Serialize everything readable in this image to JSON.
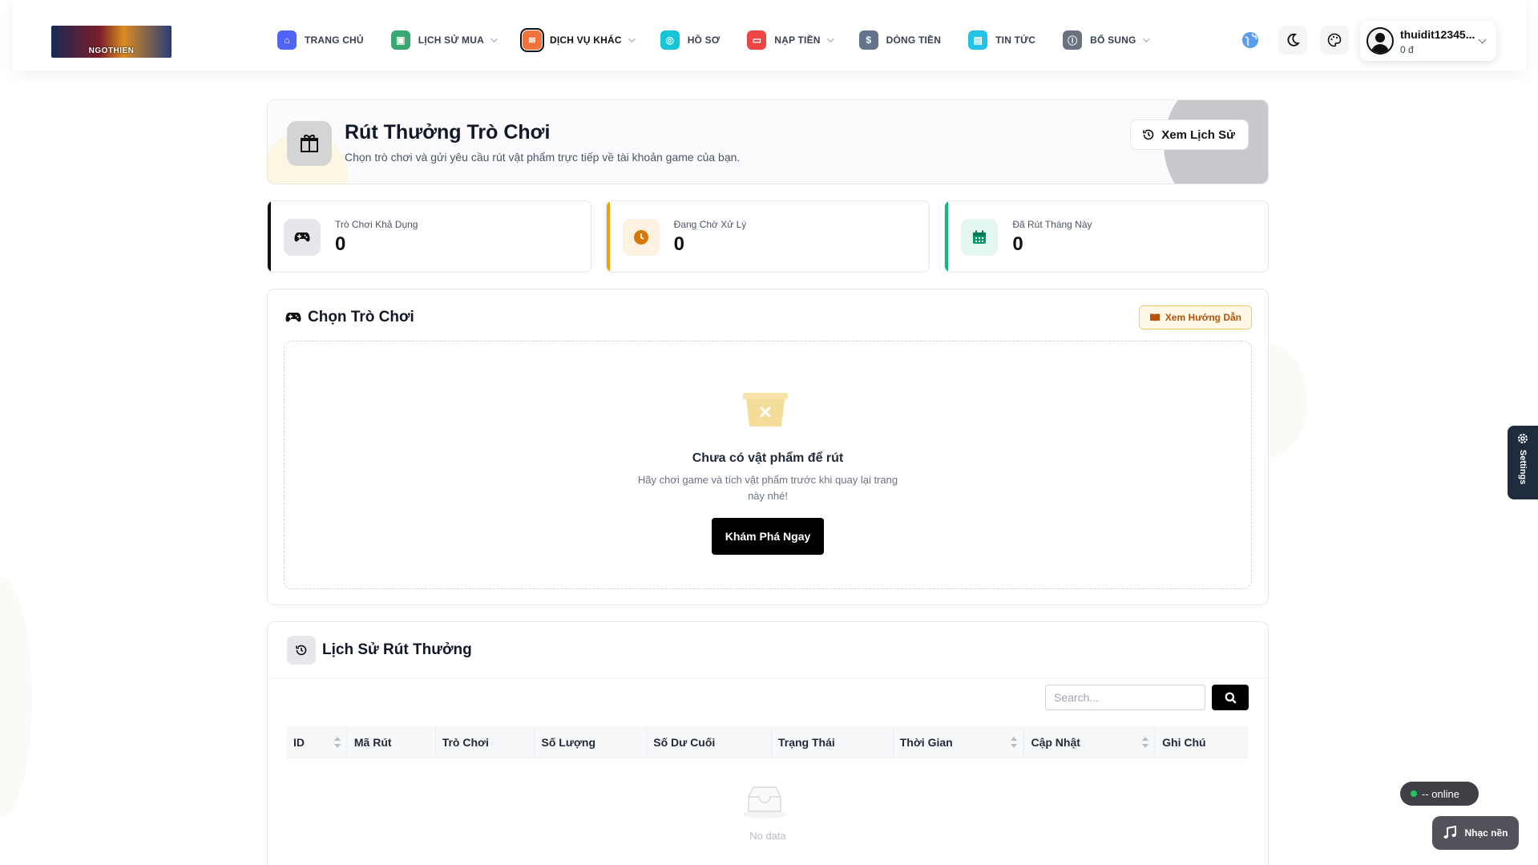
{
  "brand": {
    "logo_text": "NGOTHIEN"
  },
  "nav": [
    {
      "label": "TRANG CHỦ",
      "icon": "home-icon",
      "color": "#4f63f5",
      "caret": false,
      "active": false
    },
    {
      "label": "LỊCH SỬ MUA",
      "icon": "gamepad-icon",
      "color": "#3aa872",
      "caret": true,
      "active": false
    },
    {
      "label": "DỊCH VỤ KHÁC",
      "icon": "layers-icon",
      "color": "#f0733e",
      "caret": true,
      "active": true
    },
    {
      "label": "HỒ SƠ",
      "icon": "user-circle-icon",
      "color": "#14c6d6",
      "caret": false,
      "active": false
    },
    {
      "label": "NẠP TIỀN",
      "icon": "wallet-icon",
      "color": "#ef4444",
      "caret": true,
      "active": false
    },
    {
      "label": "DÒNG TIỀN",
      "icon": "dollar-icon",
      "color": "#64748b",
      "caret": false,
      "active": false
    },
    {
      "label": "TIN TỨC",
      "icon": "news-icon",
      "color": "#22c3e6",
      "caret": false,
      "active": false
    },
    {
      "label": "BỔ SUNG",
      "icon": "info-icon",
      "color": "#6b7280",
      "caret": true,
      "active": false
    }
  ],
  "user": {
    "name": "thuidit12345...",
    "balance": "0 đ"
  },
  "hero": {
    "title": "Rút Thưởng Trò Chơi",
    "subtitle": "Chọn trò chơi và gửi yêu cầu rút vật phẩm trực tiếp về tài khoản game của bạn.",
    "history_button": "Xem Lịch Sử"
  },
  "stats": [
    {
      "label": "Trò Chơi Khả Dụng",
      "value": "0",
      "color": "#111111",
      "icon_bg": "#e5e7eb",
      "icon": "gamepad-icon"
    },
    {
      "label": "Đang Chờ Xử Lý",
      "value": "0",
      "color": "#f59e0b",
      "icon_bg": "#fef3e2",
      "icon": "clock-icon"
    },
    {
      "label": "Đã Rút Tháng Này",
      "value": "0",
      "color": "#10b981",
      "icon_bg": "#e3f7ef",
      "icon": "calendar-icon"
    }
  ],
  "choose": {
    "title": "Chọn Trò Chơi",
    "guide_button": "Xem Hướng Dẫn",
    "empty_title": "Chưa có vật phẩm để rút",
    "empty_desc": "Hãy chơi game và tích vật phẩm trước khi quay lại trang này nhé!",
    "explore_button": "Khám Phá Ngay"
  },
  "history": {
    "title": "Lịch Sử Rút Thưởng",
    "search_placeholder": "Search...",
    "columns": [
      {
        "label": "ID",
        "sortable": true
      },
      {
        "label": "Mã Rút",
        "sortable": false
      },
      {
        "label": "Trò Chơi",
        "sortable": false
      },
      {
        "label": "Số Lượng",
        "sortable": false
      },
      {
        "label": "Số Dư Cuối",
        "sortable": false
      },
      {
        "label": "Trạng Thái",
        "sortable": false
      },
      {
        "label": "Thời Gian",
        "sortable": true
      },
      {
        "label": "Cập Nhật",
        "sortable": true
      },
      {
        "label": "Ghi Chú",
        "sortable": false
      }
    ],
    "empty_text": "No data"
  },
  "floating": {
    "settings_label": "Settings",
    "online_text": "-- online",
    "music_label": "Nhạc nền"
  }
}
